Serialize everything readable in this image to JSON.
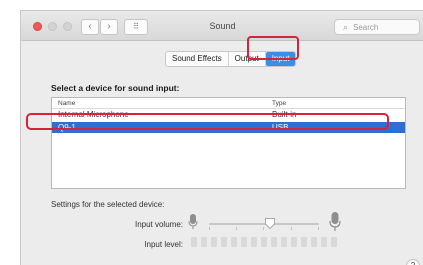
{
  "window": {
    "title": "Sound",
    "nav_back_glyph": "‹",
    "nav_forward_glyph": "›",
    "grid_glyph": "⠿"
  },
  "search": {
    "placeholder": "Search",
    "icon": "search-icon"
  },
  "tabs": [
    {
      "label": "Sound Effects",
      "active": false
    },
    {
      "label": "Output",
      "active": false
    },
    {
      "label": "Input",
      "active": true
    }
  ],
  "main": {
    "section_label": "Select a device for sound input:",
    "columns": {
      "name": "Name",
      "type": "Type"
    },
    "devices": [
      {
        "name": "Internal Microphone",
        "type": "Built-in",
        "selected": false
      },
      {
        "name": "Q9-1",
        "type": "USB",
        "selected": true
      }
    ],
    "settings_label": "Settings for the selected device:",
    "input_volume_label": "Input volume:",
    "input_volume_level": 0.55,
    "input_level_label": "Input level:",
    "input_level_segments": 15,
    "input_level_active": 0
  },
  "help": {
    "label": "?"
  },
  "colors": {
    "accent": "#3a8ee6",
    "selection": "#2f6fd0",
    "annotation": "#d6223a",
    "close": "#ee5b55"
  }
}
